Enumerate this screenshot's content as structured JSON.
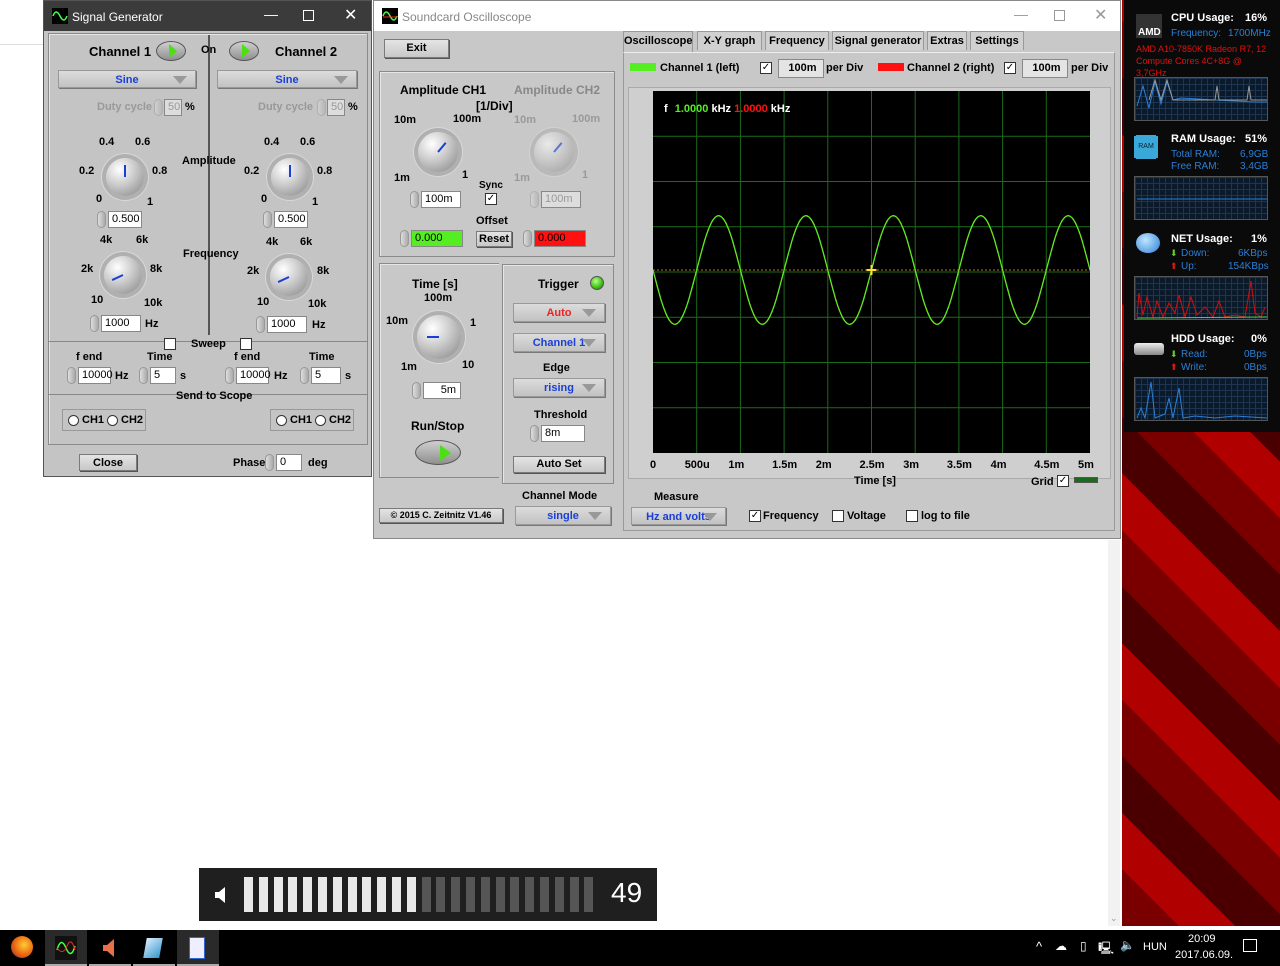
{
  "signal_generator": {
    "title": "Signal Generator",
    "on_label": "On",
    "channels": [
      {
        "name": "Channel 1",
        "waveform": "Sine",
        "duty_label": "Duty cycle",
        "duty": "50",
        "duty_unit": "%",
        "amp_ticks": [
          "0",
          "0.2",
          "0.4",
          "0.6",
          "0.8",
          "1"
        ],
        "amplitude": "0.500",
        "freq_ticks": [
          "10",
          "2k",
          "4k",
          "6k",
          "8k",
          "10k"
        ],
        "frequency": "1000",
        "freq_unit": "Hz",
        "fend_label": "f end",
        "fend": "10000",
        "fend_unit": "Hz",
        "time_label": "Time",
        "time": "5",
        "time_unit": "s",
        "ch1": "CH1",
        "ch2": "CH2"
      },
      {
        "name": "Channel 2",
        "waveform": "Sine",
        "duty_label": "Duty cycle",
        "duty": "50",
        "duty_unit": "%",
        "amp_ticks": [
          "0",
          "0.2",
          "0.4",
          "0.6",
          "0.8",
          "1"
        ],
        "amplitude": "0.500",
        "freq_ticks": [
          "10",
          "2k",
          "4k",
          "6k",
          "8k",
          "10k"
        ],
        "frequency": "1000",
        "freq_unit": "Hz",
        "fend_label": "f end",
        "fend": "10000",
        "fend_unit": "Hz",
        "time_label": "Time",
        "time": "5",
        "time_unit": "s",
        "ch1": "CH1",
        "ch2": "CH2"
      }
    ],
    "amplitude_label": "Amplitude",
    "frequency_label": "Frequency",
    "sweep_label": "Sweep",
    "send_to_scope": "Send to Scope",
    "close": "Close",
    "phase_label": "Phase",
    "phase": "0",
    "phase_unit": "deg"
  },
  "scope": {
    "title": "Soundcard Oscilloscope",
    "exit": "Exit",
    "amp_ch1": "Amplitude CH1",
    "amp_ch2": "Amplitude CH2",
    "amp_unit": "[1/Div]",
    "amp_ticks": [
      "1m",
      "10m",
      "100m",
      "1"
    ],
    "amp_ch1_value": "100m",
    "amp_ch2_value": "100m",
    "sync": "Sync",
    "offset": "Offset",
    "offset_ch1": "0.000",
    "offset_ch2": "0.000",
    "reset": "Reset",
    "time_label": "Time [s]",
    "time_ticks": [
      "1m",
      "10m",
      "100m",
      "1",
      "10"
    ],
    "time_value": "5m",
    "run_stop": "Run/Stop",
    "trigger": {
      "label": "Trigger",
      "mode": "Auto",
      "channel": "Channel 1",
      "edge_label": "Edge",
      "edge": "rising",
      "threshold_label": "Threshold",
      "threshold": "8m",
      "auto_set": "Auto Set"
    },
    "channel_mode_label": "Channel Mode",
    "channel_mode": "single",
    "copyright": "© 2015  C. Zeitnitz V1.46",
    "tabs": [
      "Oscilloscope",
      "X-Y graph",
      "Frequency",
      "Signal generator",
      "Extras",
      "Settings"
    ],
    "active_tab": "Oscilloscope",
    "ch1_label": "Channel 1 (left)",
    "ch1_div": "100m",
    "ch2_label": "Channel 2 (right)",
    "ch2_div": "100m",
    "per_div": "per Div",
    "colors": {
      "ch1": "#55ee22",
      "ch2": "#ff1111"
    },
    "readout": {
      "f": "f",
      "ch1_freq": "1.0000",
      "ch2_freq": "1.0000",
      "unit": "kHz"
    },
    "grid_label": "Grid",
    "measure_label": "Measure",
    "measure_mode": "Hz and volts",
    "m_frequency": "Frequency",
    "m_voltage": "Voltage",
    "m_log": "log to file",
    "chart_data": {
      "type": "line",
      "xlabel": "Time [s]",
      "x_ticks": [
        "0",
        "500u",
        "1m",
        "1.5m",
        "2m",
        "2.5m",
        "3m",
        "3.5m",
        "4m",
        "4.5m",
        "5m"
      ],
      "xlim": [
        0,
        0.005
      ],
      "grid": true,
      "series": [
        {
          "name": "Channel 1 (left)",
          "waveform": "sine",
          "frequency_hz": 1000,
          "amplitude_v": 0.12,
          "color": "#55ee22"
        },
        {
          "name": "Channel 2 (right)",
          "waveform": "sine",
          "frequency_hz": 1000,
          "amplitude_v": 0.12,
          "color": "#ff1111"
        }
      ],
      "trigger_time": 0.0025
    }
  },
  "sidebar": {
    "cpu": {
      "label": "CPU Usage:",
      "value": "16%",
      "freq_label": "Frequency:",
      "freq": "1700MHz",
      "model": "AMD A10-7850K Radeon R7, 12 Compute Cores 4C+8G @ 3,7GHz",
      "logo": "AMD"
    },
    "ram": {
      "label": "RAM Usage:",
      "value": "51%",
      "total_label": "Total RAM:",
      "total": "6,9GB",
      "free_label": "Free RAM:",
      "free": "3,4GB",
      "chip": "RAM"
    },
    "net": {
      "label": "NET Usage:",
      "value": "1%",
      "down_label": "Down:",
      "down": "6KBps",
      "up_label": "Up:",
      "up": "154KBps"
    },
    "hdd": {
      "label": "HDD Usage:",
      "value": "0%",
      "read_label": "Read:",
      "read": "0Bps",
      "write_label": "Write:",
      "write": "0Bps"
    }
  },
  "volume": {
    "level": "49",
    "fraction": 0.49
  },
  "taskbar": {
    "lang": "HUN",
    "time": "20:09",
    "date": "2017.06.09."
  }
}
